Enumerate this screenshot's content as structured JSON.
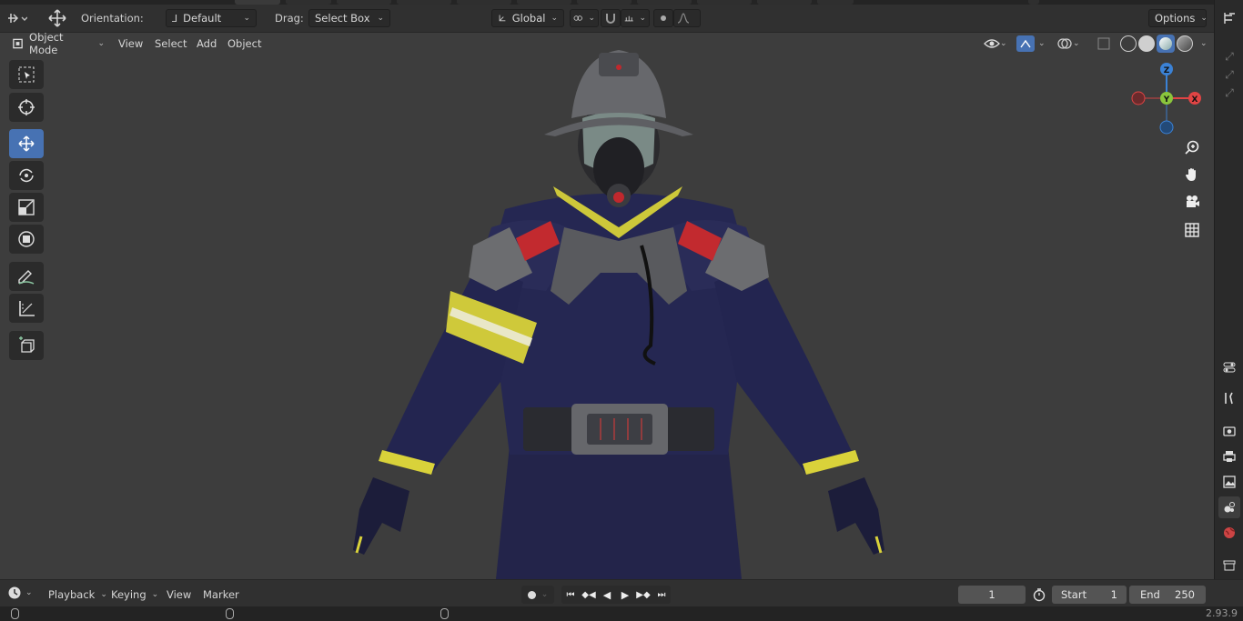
{
  "header": {
    "orientation_label": "Orientation:",
    "orientation_value": "Default",
    "drag_label": "Drag:",
    "drag_value": "Select Box",
    "transform_space": "Global",
    "options_label": "Options"
  },
  "viewport_header": {
    "mode": "Object Mode",
    "menus": [
      "View",
      "Select",
      "Add",
      "Object"
    ]
  },
  "gizmo": {
    "z": "Z",
    "y": "Y",
    "x": "X"
  },
  "toolbar": {
    "tools": [
      "select-box",
      "cursor",
      "move",
      "rotate",
      "scale",
      "transform",
      "annotate",
      "measure",
      "add-cube"
    ],
    "active": "move"
  },
  "timeline": {
    "menus": [
      "Playback",
      "Keying",
      "View",
      "Marker"
    ],
    "current_frame": "1",
    "start_label": "Start",
    "start_value": "1",
    "end_label": "End",
    "end_value": "250"
  },
  "status": {
    "version": "2.93.9"
  },
  "colors": {
    "accent": "#4772b3",
    "x_axis": "#e04444",
    "y_axis": "#8ac53c",
    "z_axis": "#3b82d6"
  }
}
